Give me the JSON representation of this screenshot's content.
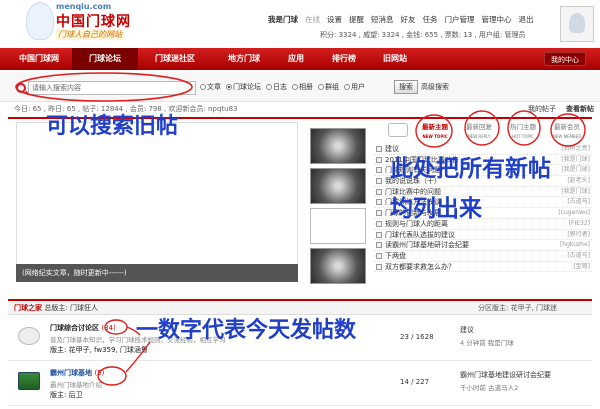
{
  "header": {
    "site_url": "menqiu.com",
    "site_name": "中国门球网",
    "slogan": "门球人自己的网站",
    "nav": [
      "我是门球",
      "在线",
      "设置",
      "提醒",
      "短消息",
      "好友",
      "任务",
      "门户管理",
      "管理中心",
      "退出"
    ],
    "stats": "积分: 3324 , 威望: 3324 , 金钱: 655 , 票数: 13 , 用户组: 管理员"
  },
  "navbar": {
    "items": [
      "中国门球网",
      "门球论坛",
      "门球迷社区",
      "地方门球",
      "应用",
      "排行榜",
      "旧网站"
    ],
    "active": "门球论坛",
    "my_center": "我的中心"
  },
  "search": {
    "placeholder": "请输入搜索内容",
    "options": [
      "文章",
      "门球论坛",
      "日志",
      "相册",
      "群组",
      "用户"
    ],
    "selected": "门球论坛",
    "button": "搜索",
    "advanced": "高级搜索"
  },
  "statline": "今日: 65 , 昨日: 65 , 帖子: 12844 , 会员: 798 , 欢迎新会员: npqtu83",
  "links": {
    "favorites": "我的帖子",
    "view_new": "查看新帖"
  },
  "slideshow": {
    "caption": "(网络纪实文章，随时更新中------)"
  },
  "tabs": [
    {
      "label": "最新主题",
      "sub": "NEW TOPIC"
    },
    {
      "label": "最新回复",
      "sub": "NEW REPLY"
    },
    {
      "label": "热门主题",
      "sub": "HOT TOPIC"
    },
    {
      "label": "最新会员",
      "sub": "NEW MEMBER"
    }
  ],
  "topics": [
    {
      "title": "建议",
      "author": "[石树之亮]"
    },
    {
      "title": "2011中国门球比赛公告",
      "author": "[我是门球]"
    },
    {
      "title": "门球规则有关问题",
      "author": "[我是门球]"
    },
    {
      "title": "我的说说珠（十）",
      "author": "[赵老头]"
    },
    {
      "title": "门球比赛中的问题",
      "author": "[我是门球]"
    },
    {
      "title": "门球训练方法浅谈",
      "author": "[古道马]"
    },
    {
      "title": "门球的创新与发展",
      "author": "[cugenwo]"
    },
    {
      "title": "规则与门球人的距离",
      "author": "[FIE32]"
    },
    {
      "title": "门球代表队选拔的建议",
      "author": "[郭行者]"
    },
    {
      "title": "读霸州门球基地研讨会纪要",
      "author": "[hgkuzhe]"
    },
    {
      "title": "下两盘",
      "author": "[古道马]"
    },
    {
      "title": "双方都要求救怎么办？",
      "author": "[宝瑕]"
    }
  ],
  "forum_section": {
    "title": "门球之家",
    "moderator_label": "总版主: 门球狂人",
    "right": "分区版主: 花甲子, 门球迷"
  },
  "forums": [
    {
      "name": "门球综合讨论区",
      "count": "(34)",
      "desc": "普及门球基本知识，学习门球技术规则，交流经验，相互学习",
      "mods": "版主: 花甲子, fw359, 门球涵鲁",
      "nums": "23 / 1628",
      "last_title": "建议",
      "last_info": "4 分钟前 我是门球"
    },
    {
      "name": "霸州门球基地",
      "count": "(5)",
      "desc": "霸州门球基地介绍",
      "mods": "版主: 后卫",
      "nums": "14 / 227",
      "last_title": "霸州门球基地建设研讨会纪要",
      "last_info": "千小时前 古道马人2"
    }
  ],
  "annotations": [
    "可以搜索旧帖",
    "此处把所有新帖",
    "均列出来",
    "一数字代表今天发帖数"
  ]
}
